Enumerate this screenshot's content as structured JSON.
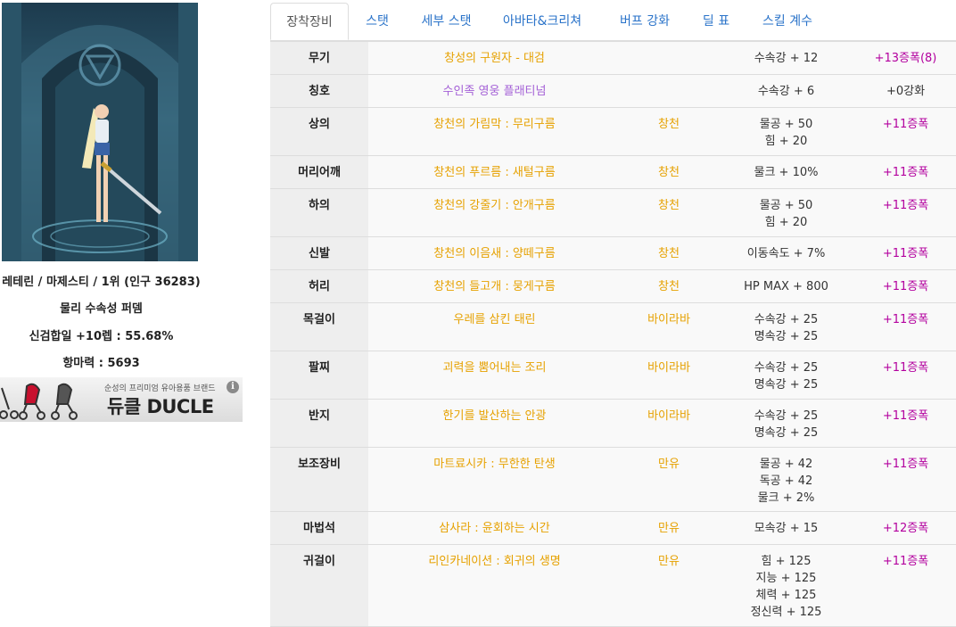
{
  "character": {
    "summary": "레테린 / 마제스티 / 1위 (인구 36283)",
    "build": "물리 수속성 퍼뎀",
    "sync": "신검합일 +10렙 : 55.68%",
    "resistance": "항마력 : 5693"
  },
  "ad": {
    "subtitle": "순성의 프리미엄 유아용품 브랜드",
    "brand": "듀클 DUCLE",
    "info_icon": "i"
  },
  "tabs": [
    {
      "label": "장착장비",
      "active": true
    },
    {
      "label": "스탯"
    },
    {
      "label": "세부 스탯"
    },
    {
      "label": "아바타&크리쳐"
    },
    {
      "label": "버프 강화"
    },
    {
      "label": "딜 표"
    },
    {
      "label": "스킬 계수"
    }
  ],
  "equipment": [
    {
      "slot": "무기",
      "item": "창성의 구원자 - 대검",
      "set": "",
      "stats": [
        "수속강 + 12"
      ],
      "enhance": "+13증폭(8)"
    },
    {
      "slot": "칭호",
      "item": "수인족 영웅 플래티넘",
      "set": "",
      "stats": [
        "수속강 + 6"
      ],
      "enhance": "+0강화"
    },
    {
      "slot": "상의",
      "item": "창천의 가림막 : 무리구름",
      "set": "창천",
      "stats": [
        "물공 + 50",
        "힘 + 20"
      ],
      "enhance": "+11증폭"
    },
    {
      "slot": "머리어깨",
      "item": "창천의 푸르름 : 새털구름",
      "set": "창천",
      "stats": [
        "물크 + 10%"
      ],
      "enhance": "+11증폭"
    },
    {
      "slot": "하의",
      "item": "창천의 강줄기 : 안개구름",
      "set": "창천",
      "stats": [
        "물공 + 50",
        "힘 + 20"
      ],
      "enhance": "+11증폭"
    },
    {
      "slot": "신발",
      "item": "창천의 이음새 : 양떼구름",
      "set": "창천",
      "stats": [
        "이동속도 + 7%"
      ],
      "enhance": "+11증폭"
    },
    {
      "slot": "허리",
      "item": "창천의 들고개 : 뭉게구름",
      "set": "창천",
      "stats": [
        "HP MAX + 800"
      ],
      "enhance": "+11증폭"
    },
    {
      "slot": "목걸이",
      "item": "우레를 삼킨 태린",
      "set": "바이라바",
      "stats": [
        "수속강 + 25",
        "명속강 + 25"
      ],
      "enhance": "+11증폭"
    },
    {
      "slot": "팔찌",
      "item": "괴력을 뿜어내는 조리",
      "set": "바이라바",
      "stats": [
        "수속강 + 25",
        "명속강 + 25"
      ],
      "enhance": "+11증폭"
    },
    {
      "slot": "반지",
      "item": "한기를 발산하는 안광",
      "set": "바이라바",
      "stats": [
        "수속강 + 25",
        "명속강 + 25"
      ],
      "enhance": "+11증폭"
    },
    {
      "slot": "보조장비",
      "item": "마트료시카 : 무한한 탄생",
      "set": "만유",
      "stats": [
        "물공 + 42",
        "독공 + 42",
        "물크 + 2%"
      ],
      "enhance": "+11증폭"
    },
    {
      "slot": "마법석",
      "item": "삼사라 : 윤회하는 시간",
      "set": "만유",
      "stats": [
        "모속강 + 15"
      ],
      "enhance": "+12증폭"
    },
    {
      "slot": "귀걸이",
      "item": "리인카네이션 : 회귀의 생명",
      "set": "만유",
      "stats": [
        "힘 + 125",
        "지능 + 125",
        "체력 + 125",
        "정신력 + 125"
      ],
      "enhance": "+11증폭"
    }
  ],
  "colors": {
    "item_gold": "#e6a100",
    "item_purple": "#a35fd6",
    "enhance_magenta": "#b3009e",
    "tab_link": "#2a73c9"
  }
}
